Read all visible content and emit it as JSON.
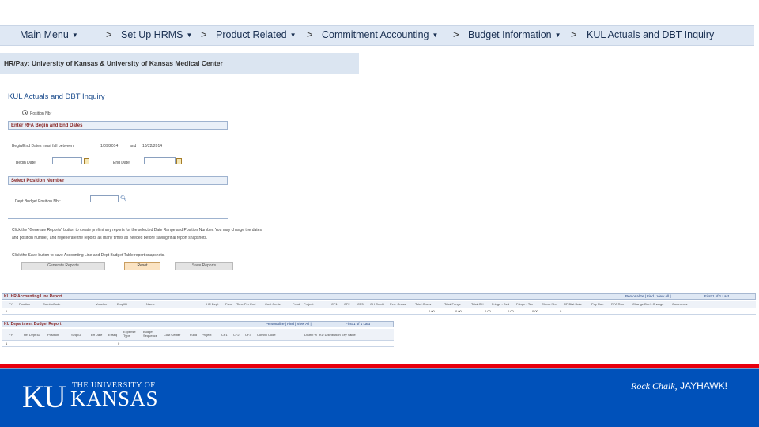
{
  "breadcrumb": {
    "items": [
      {
        "label": "Main Menu",
        "dropdown": true
      },
      {
        "label": "Set Up HRMS",
        "dropdown": true
      },
      {
        "label": "Product Related",
        "dropdown": true
      },
      {
        "label": "Commitment Accounting",
        "dropdown": true
      },
      {
        "label": "Budget Information",
        "dropdown": true
      },
      {
        "label": "KUL Actuals and DBT Inquiry",
        "dropdown": false
      }
    ],
    "separator": ">",
    "dropdown_glyph": "▼"
  },
  "header": {
    "institution": "HR/Pay: University of Kansas & University of Kansas Medical Center"
  },
  "page": {
    "title": "KUL Actuals and DBT Inquiry",
    "position_nbr_option": "Position Nbr",
    "rfa_section": {
      "heading": "Enter RFA Begin and End Dates",
      "range_label": "Begin/End Dates must fall between:",
      "range_start": "1/09/2014",
      "range_and": "and",
      "range_end": "10/22/2014",
      "begin_label": "Begin Date:",
      "end_label": "End Date:"
    },
    "position_section": {
      "heading": "Select Position Number",
      "field_label": "Dept Budget Position Nbr:"
    },
    "instructions": [
      "Click the \"Generate Reports\" button to create preliminary reports for the selected Date Range and Position Number. You may change the dates",
      "and position number, and regenerate the reports as many times as needed before saving final report snapshots.",
      "Click the Save button to save Accounting Line and Dept Budget Table report snapshots."
    ],
    "buttons": {
      "generate": "Generate Reports",
      "reset": "Reset",
      "save": "Save Reports"
    }
  },
  "accounting_grid": {
    "title": "KU HR Accounting Line Report",
    "nav": "Personalize | Find | View All | ",
    "paging": "First  1 of 1  Last",
    "columns": [
      "FY",
      "Position",
      "ComboCode",
      "Voucher",
      "EmplID",
      "Name",
      "HR Dept",
      "Fund",
      "Time Per End",
      "Cost Center",
      "Fund",
      "Project",
      "CF1",
      "CF2",
      "CF3",
      "OH Credit",
      "Pen. Gross",
      "Total Gross",
      "Total Fringe",
      "Total OH",
      "Fringe - Ded",
      "Fringe - Tax",
      "Check Nbr",
      "RF Dist Date",
      "Pay Run",
      "RFA Run",
      "Change/Don't Change",
      "Comments"
    ],
    "row": {
      "index": "1",
      "total_gross": "0.00",
      "total_fringe": "0.00",
      "total_oh": "0.00",
      "fringe_ded": "0.00",
      "fringe_tax": "0.00",
      "check_nbr": "0"
    }
  },
  "budget_grid": {
    "title": "KU Department Budget Report",
    "nav": "Personalize | Find | View All | ",
    "paging": "First  1 of 1  Last",
    "columns": [
      "FY",
      "HR Dept ID",
      "Position",
      "Seq ID",
      "Eff Date",
      "Effseq",
      "Expense Type",
      "Budget Sequence",
      "Cost Center",
      "Fund",
      "Project",
      "CF1",
      "CF2",
      "CF3",
      "Combo Code",
      "Distrib %",
      "KU Distribution Key Value"
    ],
    "row": {
      "index": "1",
      "value": "0"
    }
  },
  "footer": {
    "logo_mono": "KU",
    "logo_the": "THE UNIVERSITY OF",
    "logo_kansas": "KANSAS",
    "tagline_italic": "Rock Chalk,",
    "tagline_caps": "JAYHAWK!"
  },
  "colors": {
    "ku_blue": "#0051ba",
    "ku_red": "#e8000d",
    "breadcrumb_bg": "#dfe8f4"
  }
}
